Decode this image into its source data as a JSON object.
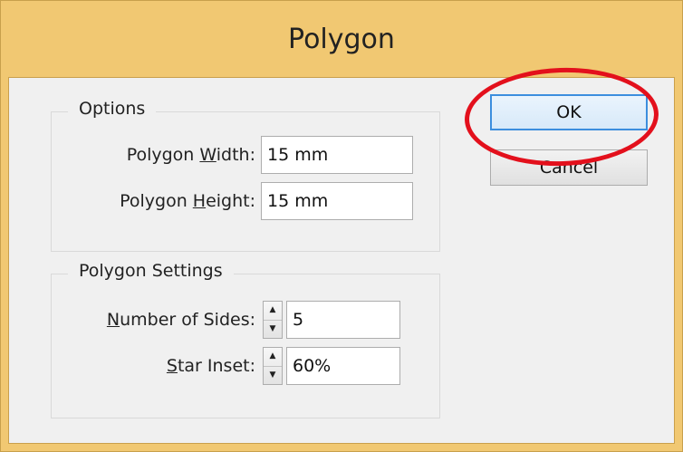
{
  "window": {
    "title": "Polygon"
  },
  "options": {
    "group_title": "Options",
    "width_label_pre": "Polygon ",
    "width_label_mnemonic": "W",
    "width_label_post": "idth:",
    "width_value": "15 mm",
    "height_label_pre": "Polygon ",
    "height_label_mnemonic": "H",
    "height_label_post": "eight:",
    "height_value": "15 mm"
  },
  "polygon_settings": {
    "group_title": "Polygon Settings",
    "sides_label_mnemonic": "N",
    "sides_label_post": "umber of Sides:",
    "sides_value": "5",
    "inset_label_mnemonic": "S",
    "inset_label_post": "tar Inset:",
    "inset_value": "60%"
  },
  "buttons": {
    "ok_label": "OK",
    "cancel_label": "Cancel"
  },
  "annotation": {
    "color": "#e3101c",
    "target": "ok-button"
  },
  "colors": {
    "frame": "#f1c872",
    "client": "#f0f0f0",
    "default_button_border": "#3c8ede"
  }
}
